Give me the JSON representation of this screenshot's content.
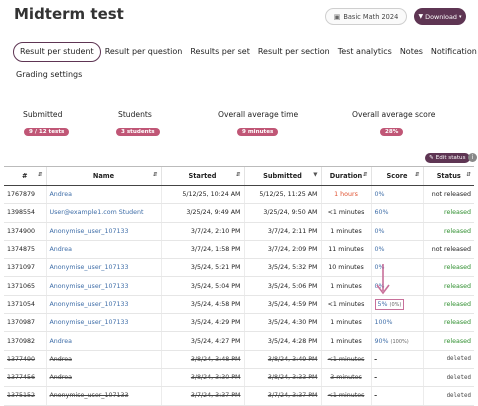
{
  "header": {
    "title": "Midterm test",
    "course_button": "Basic Math 2024",
    "download_button": "Download"
  },
  "tabs": [
    {
      "label": "Result per student",
      "active": true
    },
    {
      "label": "Result per question"
    },
    {
      "label": "Results per set"
    },
    {
      "label": "Result per section"
    },
    {
      "label": "Test analytics"
    },
    {
      "label": "Notes"
    },
    {
      "label": "Notification"
    },
    {
      "label": "Grading settings"
    }
  ],
  "stats": {
    "submitted": {
      "label": "Submitted",
      "value": "9 / 12 tests"
    },
    "students": {
      "label": "Students",
      "value": "3 students"
    },
    "avg_time": {
      "label": "Overall average time",
      "value": "9 minutes"
    },
    "avg_score": {
      "label": "Overall average score",
      "value": "28%"
    }
  },
  "edit_status": "Edit status",
  "table": {
    "headers": [
      "#",
      "Name",
      "Started",
      "Submitted",
      "Duration",
      "Score",
      "Status"
    ],
    "rows": [
      {
        "id": "1767879",
        "name": "Andrea",
        "started": "5/12/25, 10:24 AM",
        "submitted": "5/12/25, 11:25 AM",
        "duration": "1 hours",
        "score": "0%",
        "score_extra": "",
        "status": "not released"
      },
      {
        "id": "1398554",
        "name": "User@example1.com Student",
        "started": "3/25/24, 9:49 AM",
        "submitted": "3/25/24, 9:50 AM",
        "duration": "<1 minutes",
        "score": "60%",
        "score_extra": "",
        "status": "released"
      },
      {
        "id": "1374900",
        "name": "Anonymise_user_107133",
        "started": "3/7/24, 2:10 PM",
        "submitted": "3/7/24, 2:11 PM",
        "duration": "1 minutes",
        "score": "0%",
        "score_extra": "",
        "status": "released"
      },
      {
        "id": "1374875",
        "name": "Andrea",
        "started": "3/7/24, 1:58 PM",
        "submitted": "3/7/24, 2:09 PM",
        "duration": "11 minutes",
        "score": "0%",
        "score_extra": "",
        "status": "not released"
      },
      {
        "id": "1371097",
        "name": "Anonymise_user_107133",
        "started": "3/5/24, 5:21 PM",
        "submitted": "3/5/24, 5:32 PM",
        "duration": "10 minutes",
        "score": "0%",
        "score_extra": "",
        "status": "released"
      },
      {
        "id": "1371065",
        "name": "Anonymise_user_107133",
        "started": "3/5/24, 5:04 PM",
        "submitted": "3/5/24, 5:06 PM",
        "duration": "1 minutes",
        "score": "0%",
        "score_extra": "",
        "status": "released"
      },
      {
        "id": "1371054",
        "name": "Anonymise_user_107133",
        "started": "3/5/24, 4:58 PM",
        "submitted": "3/5/24, 4:59 PM",
        "duration": "<1 minutes",
        "score": "5%",
        "score_extra": "(0%)",
        "status": "released"
      },
      {
        "id": "1370987",
        "name": "Anonymise_user_107133",
        "started": "3/5/24, 4:29 PM",
        "submitted": "3/5/24, 4:30 PM",
        "duration": "1 minutes",
        "score": "100%",
        "score_extra": "",
        "status": "released"
      },
      {
        "id": "1370982",
        "name": "Andrea",
        "started": "3/5/24, 4:27 PM",
        "submitted": "3/5/24, 4:28 PM",
        "duration": "1 minutes",
        "score": "90%",
        "score_extra": "(100%)",
        "status": "released"
      },
      {
        "id": "1377490",
        "name": "Andrea",
        "started": "3/8/24, 3:48 PM",
        "submitted": "3/8/24, 3:49 PM",
        "duration": "<1 minutes",
        "score": "-",
        "score_extra": "",
        "status": "deleted"
      },
      {
        "id": "1377456",
        "name": "Andrea",
        "started": "3/8/24, 3:30 PM",
        "submitted": "3/8/24, 3:33 PM",
        "duration": "3 minutes",
        "score": "-",
        "score_extra": "",
        "status": "deleted"
      },
      {
        "id": "1375152",
        "name": "Anonymise_user_107133",
        "started": "3/7/24, 3:37 PM",
        "submitted": "3/7/24, 3:37 PM",
        "duration": "<1 minutes",
        "score": "-",
        "score_extra": "",
        "status": "deleted"
      }
    ]
  }
}
